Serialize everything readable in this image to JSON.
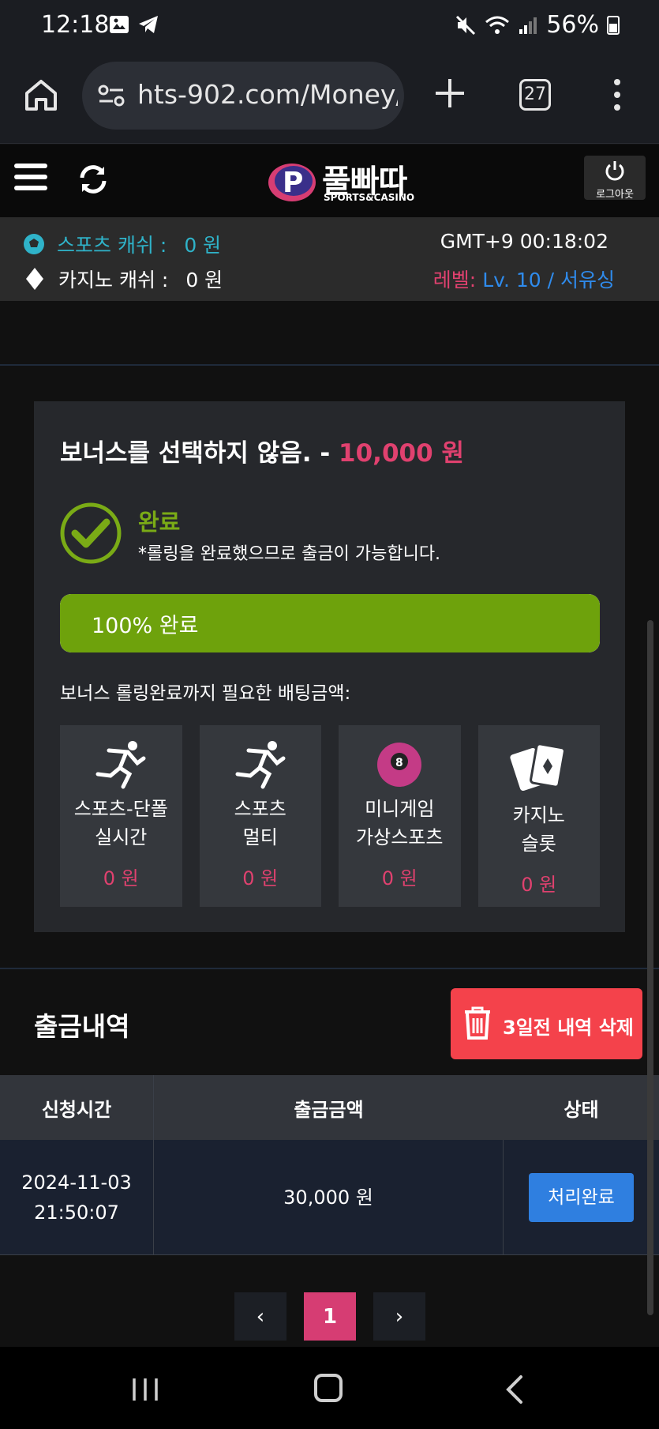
{
  "status_bar": {
    "time": "12:18",
    "battery": "56%"
  },
  "browser": {
    "url": "hts-902.com/Money/",
    "tab_count": "27"
  },
  "header": {
    "logo_text": "풀빠따",
    "logo_sub": "SPORTS&CASINO",
    "logout_label": "로그아웃"
  },
  "info": {
    "sports_label": "스포츠 캐쉬 :",
    "sports_value": "0 원",
    "casino_label": "카지노 캐쉬 :",
    "casino_value": "0 원",
    "gmt": "GMT+9 00:18:02",
    "level_label": "레벨:",
    "level_value": "Lv. 10 / 서유싱"
  },
  "bonus": {
    "title": "보너스를 선택하지 않음. -",
    "amount": "10,000 원",
    "done_label": "완료",
    "done_note": "*롤링을 완료했으므로 출금이 가능합니다.",
    "progress_percent": 100,
    "progress_label": "100% 완료",
    "requirement_label": "보너스 롤링완료까지 필요한 배팅금액:",
    "categories": [
      {
        "line1": "스포츠-단폴",
        "line2": "실시간",
        "value": "0 원",
        "icon": "runner-icon"
      },
      {
        "line1": "스포츠",
        "line2": "멀티",
        "value": "0 원",
        "icon": "runner-icon"
      },
      {
        "line1": "미니게임",
        "line2": "가상스포츠",
        "value": "0 원",
        "icon": "eight-ball-icon"
      },
      {
        "line1": "카지노",
        "line2": "슬롯",
        "value": "0 원",
        "icon": "cards-icon"
      }
    ]
  },
  "withdrawals": {
    "title": "출금내역",
    "delete_label": "3일전 내역 삭제",
    "columns": [
      "신청시간",
      "출금금액",
      "상태"
    ],
    "rows": [
      {
        "date": "2024-11-03",
        "time": "21:50:07",
        "amount": "30,000 원",
        "status": "처리완료"
      }
    ]
  },
  "pagination": {
    "prev": "‹",
    "current": "1",
    "next": "›"
  },
  "colors": {
    "accent_pink": "#e0416f",
    "accent_green": "#6ea20c",
    "accent_blue": "#2f7fe0",
    "delete_red": "#f4424b"
  }
}
